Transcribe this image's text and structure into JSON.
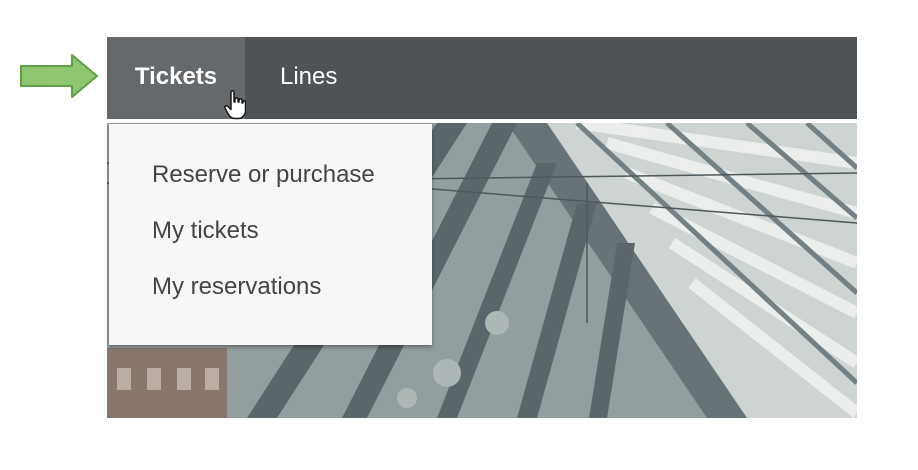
{
  "nav": {
    "items": [
      {
        "label": "Tickets",
        "active": true
      },
      {
        "label": "Lines",
        "active": false
      }
    ]
  },
  "dropdown": {
    "items": [
      {
        "label": "Reserve or purchase"
      },
      {
        "label": "My tickets"
      },
      {
        "label": "My reservations"
      }
    ]
  },
  "colors": {
    "navbar": "#4f5356",
    "active_tab": "#65696c",
    "dropdown_bg": "#f7f7f7",
    "menu_text": "#444444",
    "arrow_fill": "#8cc66f",
    "arrow_stroke": "#5f9e45"
  },
  "icons": {
    "pointer_arrow": "right-arrow-icon",
    "mouse_cursor": "hand-pointer-cursor-icon"
  }
}
